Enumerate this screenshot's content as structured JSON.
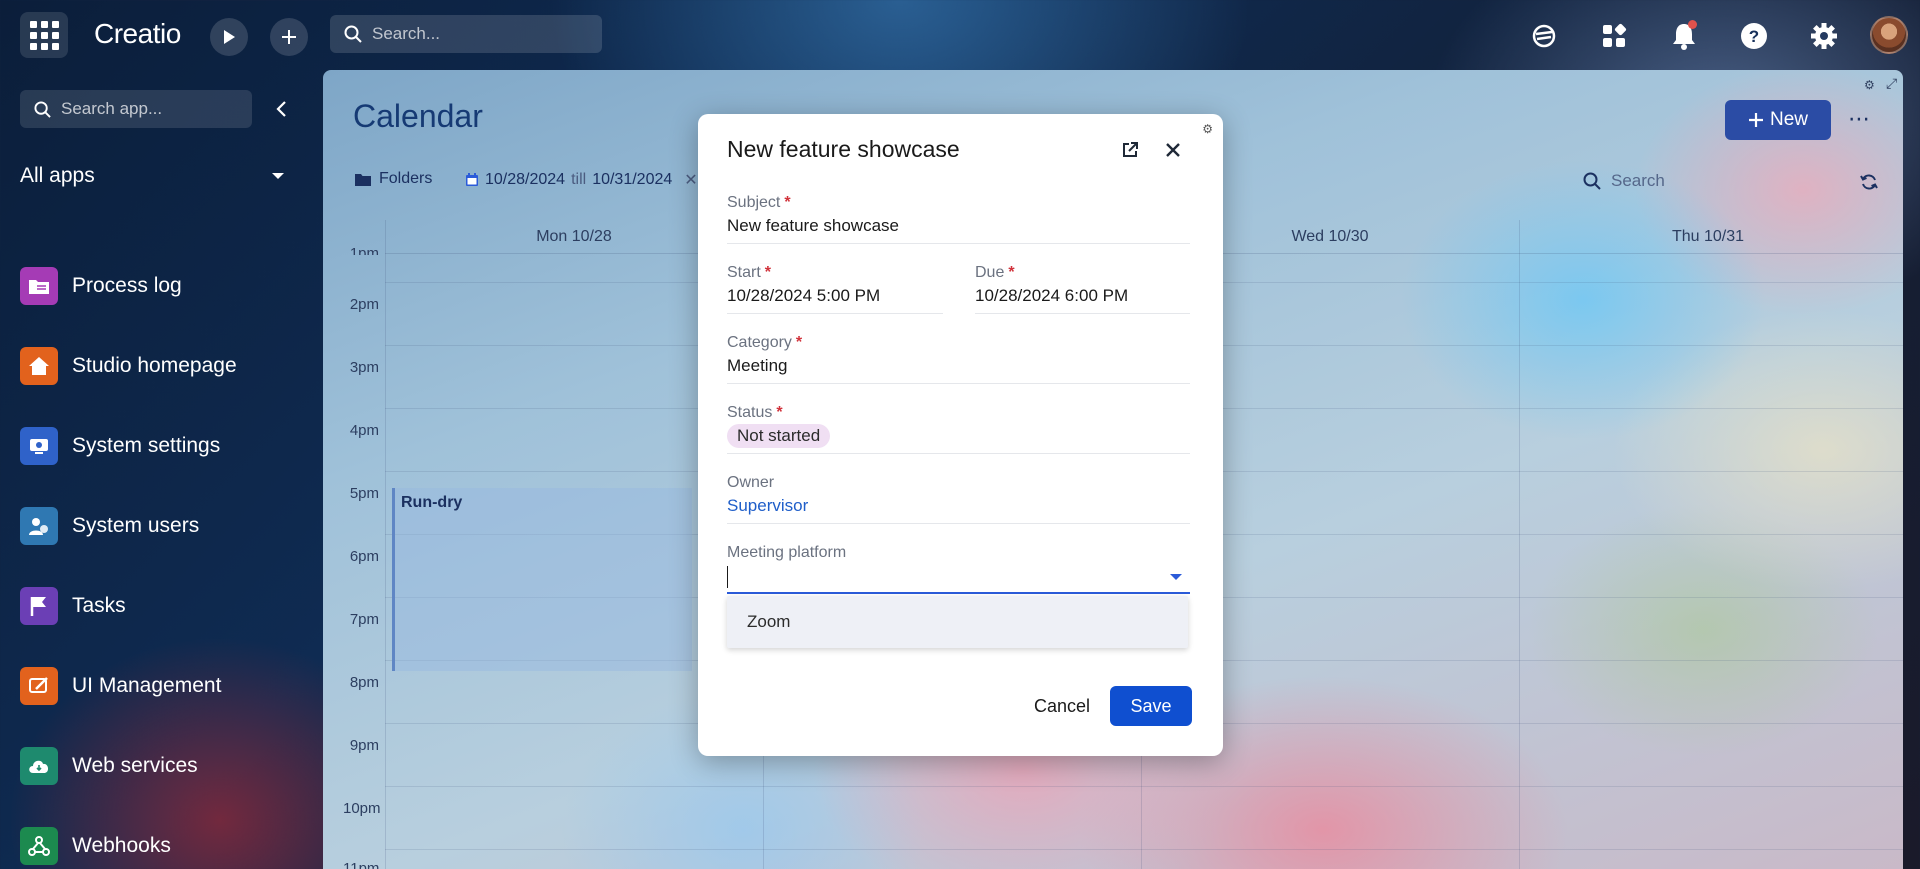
{
  "topbar": {
    "logo": "Creatio",
    "search_placeholder": "Search...",
    "icons": [
      "apps-grid-icon",
      "play-icon",
      "plus-icon",
      "search-icon",
      "tiger-icon",
      "apps-icon",
      "bell-icon",
      "help-icon",
      "gear-icon",
      "avatar"
    ]
  },
  "sidebar": {
    "search_placeholder": "Search app...",
    "section_title": "All apps",
    "items": [
      {
        "label": "Process log",
        "icon": "process-log-icon",
        "color": "#a53bb5"
      },
      {
        "label": "Studio homepage",
        "icon": "home-icon",
        "color": "#e2621d"
      },
      {
        "label": "System settings",
        "icon": "settings-icon",
        "color": "#2f62c9"
      },
      {
        "label": "System users",
        "icon": "users-icon",
        "color": "#2f78b2"
      },
      {
        "label": "Tasks",
        "icon": "flag-icon",
        "color": "#6b3fb5"
      },
      {
        "label": "UI Management",
        "icon": "ui-icon",
        "color": "#e2621d"
      },
      {
        "label": "Web services",
        "icon": "cloud-icon",
        "color": "#1e8a6e"
      },
      {
        "label": "Webhooks",
        "icon": "webhook-icon",
        "color": "#1c8a4f"
      }
    ]
  },
  "main": {
    "title": "Calendar",
    "new_label": "New",
    "folders_label": "Folders",
    "date_from": "10/28/2024",
    "date_till": "till",
    "date_to": "10/31/2024",
    "search_placeholder": "Search",
    "days": [
      "Mon 10/28",
      "Wed 10/30",
      "Thu 10/31"
    ],
    "hours": [
      "1pm",
      "2pm",
      "3pm",
      "4pm",
      "5pm",
      "6pm",
      "7pm",
      "8pm",
      "9pm",
      "10pm",
      "11pm"
    ],
    "event_title": "Run-dry"
  },
  "modal": {
    "title": "New feature showcase",
    "subject": {
      "label": "Subject",
      "value": "New feature showcase"
    },
    "start": {
      "label": "Start",
      "value": "10/28/2024 5:00 PM"
    },
    "due": {
      "label": "Due",
      "value": "10/28/2024 6:00 PM"
    },
    "category": {
      "label": "Category",
      "value": "Meeting"
    },
    "status": {
      "label": "Status",
      "value": "Not started"
    },
    "owner": {
      "label": "Owner",
      "value": "Supervisor"
    },
    "meeting_platform": {
      "label": "Meeting platform",
      "value": ""
    },
    "dropdown_options": [
      "Zoom"
    ],
    "cancel_label": "Cancel",
    "save_label": "Save"
  },
  "colors": {
    "accent": "#0f4fd0",
    "title": "#163a74",
    "required": "#d1323b",
    "status_pill": "#f0dff3"
  }
}
